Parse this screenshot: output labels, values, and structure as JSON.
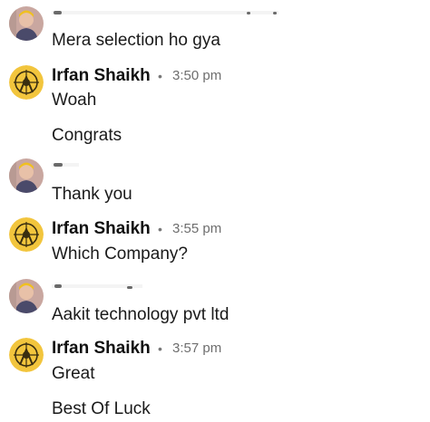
{
  "messages": [
    {
      "sender": "",
      "time": "",
      "lines": [
        "Mera selection ho gya"
      ],
      "avatar": "user-photo-avatar"
    },
    {
      "sender": "Irfan Shaikh",
      "time": "3:50 pm",
      "lines": [
        "Woah",
        "Congrats"
      ],
      "avatar": "compass-logo-avatar"
    },
    {
      "sender": "",
      "time": "",
      "lines": [
        "Thank you"
      ],
      "avatar": "user-photo-avatar"
    },
    {
      "sender": "Irfan Shaikh",
      "time": "3:55 pm",
      "lines": [
        "Which Company?"
      ],
      "avatar": "compass-logo-avatar"
    },
    {
      "sender": "",
      "time": "",
      "lines": [
        "Aakit technology pvt ltd"
      ],
      "avatar": "user-photo-avatar"
    },
    {
      "sender": "Irfan Shaikh",
      "time": "3:57 pm",
      "lines": [
        "Great",
        "Best Of Luck"
      ],
      "avatar": "compass-logo-avatar"
    }
  ],
  "separator": "•",
  "colors": {
    "background": "#ffffff",
    "text": "#1a1a1a",
    "timestamp": "#6e6e6e",
    "logo_avatar_bg": "#f2c53d"
  }
}
